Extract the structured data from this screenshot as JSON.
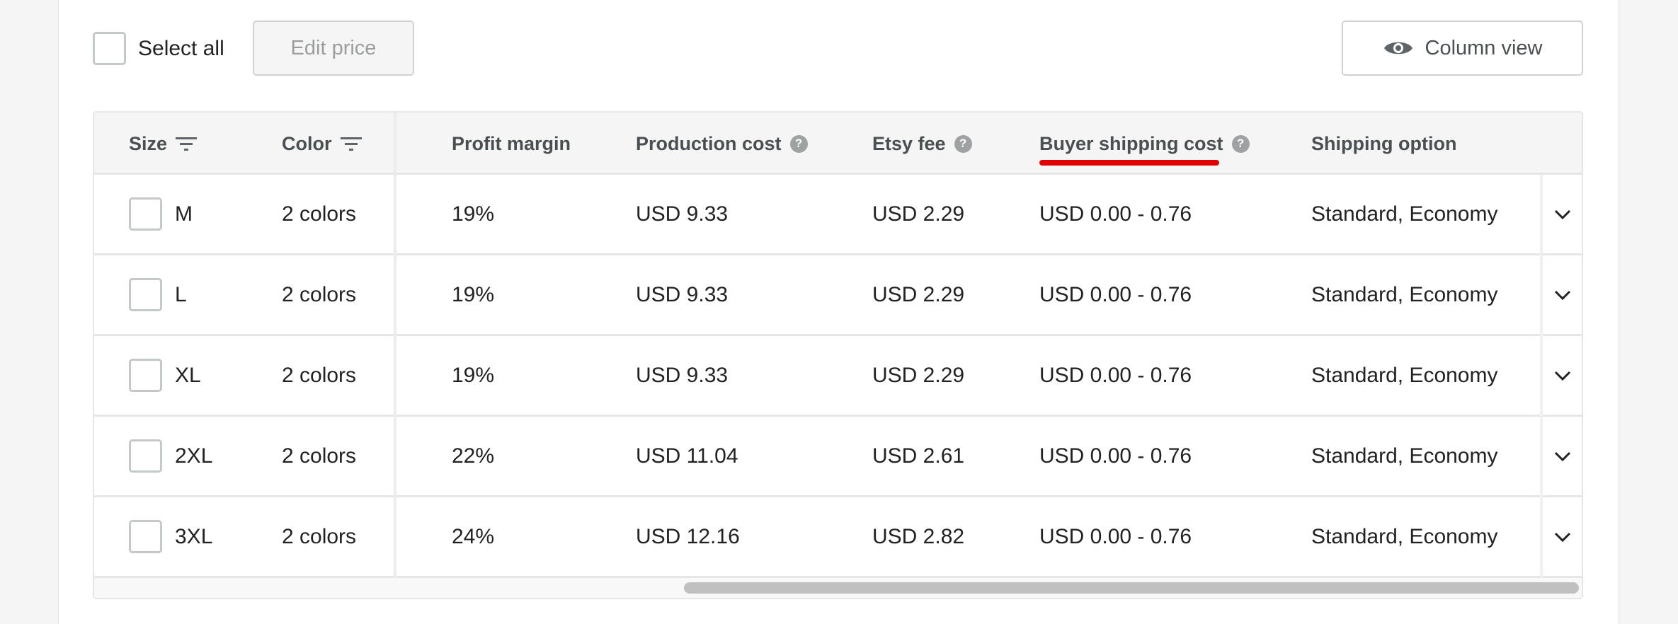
{
  "toolbar": {
    "select_all": "Select all",
    "edit_price": "Edit price",
    "column_view": "Column view"
  },
  "table": {
    "headers": {
      "size": "Size",
      "color": "Color",
      "profit": "Profit margin",
      "production": "Production cost",
      "etsy": "Etsy fee",
      "buyer_shipping": "Buyer shipping cost",
      "shipping_option": "Shipping option",
      "help": "?"
    },
    "highlight_color": "#e00000",
    "rows": [
      {
        "size": "M",
        "color": "2 colors",
        "profit": "19%",
        "production": "USD 9.33",
        "etsy": "USD 2.29",
        "buyer_shipping": "USD 0.00 - 0.76",
        "shipping_option": "Standard, Economy"
      },
      {
        "size": "L",
        "color": "2 colors",
        "profit": "19%",
        "production": "USD 9.33",
        "etsy": "USD 2.29",
        "buyer_shipping": "USD 0.00 - 0.76",
        "shipping_option": "Standard, Economy"
      },
      {
        "size": "XL",
        "color": "2 colors",
        "profit": "19%",
        "production": "USD 9.33",
        "etsy": "USD 2.29",
        "buyer_shipping": "USD 0.00 - 0.76",
        "shipping_option": "Standard, Economy"
      },
      {
        "size": "2XL",
        "color": "2 colors",
        "profit": "22%",
        "production": "USD 11.04",
        "etsy": "USD 2.61",
        "buyer_shipping": "USD 0.00 - 0.76",
        "shipping_option": "Standard, Economy"
      },
      {
        "size": "3XL",
        "color": "2 colors",
        "profit": "24%",
        "production": "USD 12.16",
        "etsy": "USD 2.82",
        "buyer_shipping": "USD 0.00 - 0.76",
        "shipping_option": "Standard, Economy"
      }
    ]
  }
}
